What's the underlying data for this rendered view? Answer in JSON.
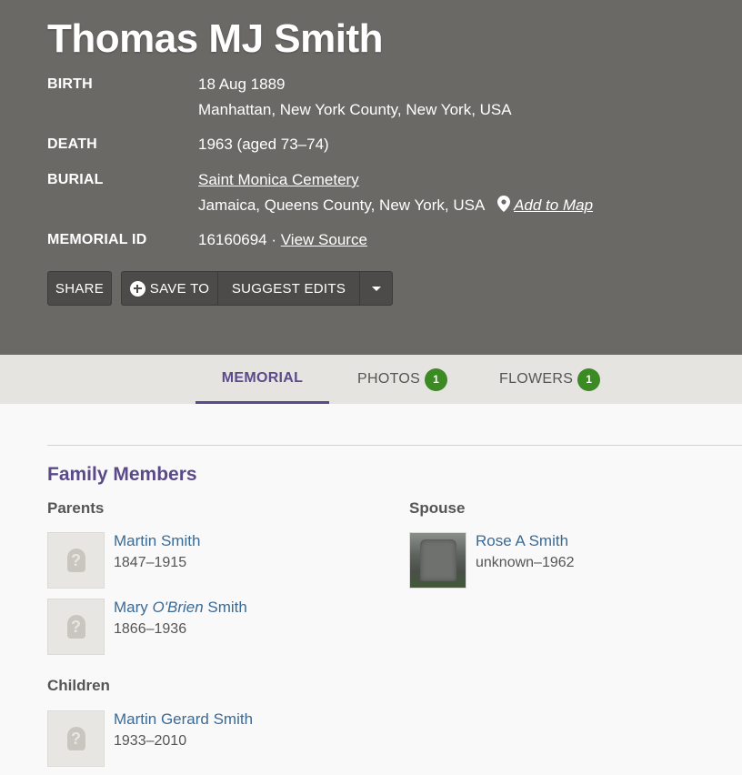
{
  "memorial": {
    "name": "Thomas MJ Smith",
    "birth_label": "BIRTH",
    "birth_date": "18 Aug 1889",
    "birth_place": "Manhattan, New York County, New York, USA",
    "death_label": "DEATH",
    "death_value": "1963 (aged 73–74)",
    "burial_label": "BURIAL",
    "burial_cemetery": "Saint Monica Cemetery",
    "burial_place": "Jamaica, Queens County, New York, USA",
    "add_to_map": "Add to Map",
    "memorial_id_label": "MEMORIAL ID",
    "memorial_id": "16160694 ·",
    "view_source": "View Source"
  },
  "actions": {
    "share": "SHARE",
    "save_to": "SAVE TO",
    "suggest_edits": "SUGGEST EDITS"
  },
  "tabs": [
    {
      "label": "MEMORIAL",
      "active": true
    },
    {
      "label": "PHOTOS",
      "count": "1"
    },
    {
      "label": "FLOWERS",
      "count": "1"
    }
  ],
  "family": {
    "title": "Family Members",
    "parents_label": "Parents",
    "spouse_label": "Spouse",
    "children_label": "Children",
    "parents": [
      {
        "name": "Martin Smith",
        "dates": "1847–1915"
      },
      {
        "first": "Mary",
        "maiden": "O'Brien",
        "last": "Smith",
        "dates": "1866–1936"
      }
    ],
    "spouse": [
      {
        "name": "Rose A Smith",
        "dates": "unknown–1962"
      }
    ],
    "children": [
      {
        "name": "Martin Gerard Smith",
        "dates": "1933–2010"
      }
    ]
  },
  "colors": {
    "header_bg": "#6b6966",
    "accent_purple": "#5a4a8a",
    "link_blue": "#3a6a96",
    "badge_green": "#3b8a24"
  },
  "icons": [
    "plus-circle-icon",
    "caret-down-icon",
    "map-pin-icon",
    "unknown-person-icon"
  ]
}
